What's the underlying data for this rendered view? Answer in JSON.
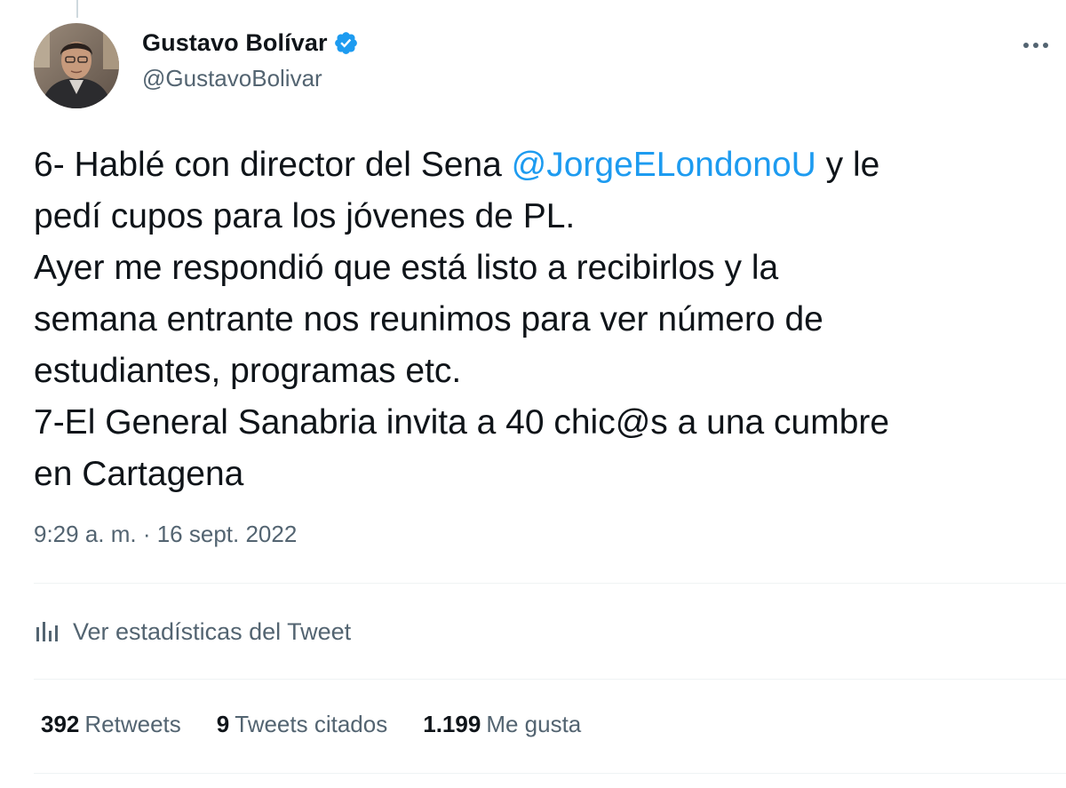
{
  "author": {
    "display_name": "Gustavo Bolívar",
    "handle": "@GustavoBolivar",
    "verified": true
  },
  "tweet": {
    "segments": [
      {
        "text": "6- Hablé con director del Sena ",
        "type": "text"
      },
      {
        "text": "@JorgeELondonoU",
        "type": "mention"
      },
      {
        "text": " y le\npedí cupos para los jóvenes de PL.\nAyer me respondió que está listo a recibirlos y la\nsemana entrante nos reunimos para ver número de\nestudiantes, programas etc.\n7-El General Sanabria invita a 40 chic@s a una cumbre\nen Cartagena",
        "type": "text"
      }
    ],
    "timestamp": "9:29 a. m. · 16 sept. 2022"
  },
  "analytics": {
    "label": "Ver estadísticas del Tweet",
    "icon": "bar-chart-icon"
  },
  "stats": {
    "retweets": {
      "count": "392",
      "label": "Retweets"
    },
    "quotes": {
      "count": "9",
      "label": "Tweets citados"
    },
    "likes": {
      "count": "1.199",
      "label": "Me gusta"
    }
  },
  "colors": {
    "text": "#0f1419",
    "secondary": "#536471",
    "accent": "#1d9bf0",
    "divider": "#eff3f4"
  },
  "icons": {
    "verified": "verified-badge-icon",
    "more": "more-options-icon"
  }
}
